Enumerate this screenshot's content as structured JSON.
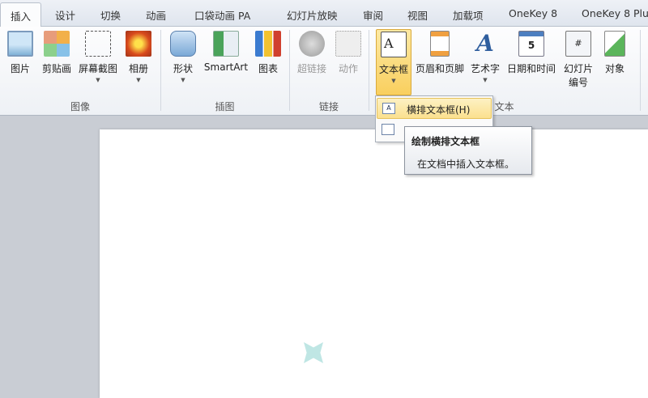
{
  "tabs": [
    "插入",
    "设计",
    "切换",
    "动画",
    "口袋动画 PA",
    "幻灯片放映",
    "审阅",
    "视图",
    "加载项",
    "OneKey 8",
    "OneKey 8 Plus"
  ],
  "groups": {
    "images": "图像",
    "illustrations": "插图",
    "links": "链接",
    "text": "文本"
  },
  "buttons": {
    "picture": "图片",
    "clipart": "剪贴画",
    "screenshot": "屏幕截图",
    "album": "相册",
    "shapes": "形状",
    "smartart": "SmartArt",
    "chart": "图表",
    "hyperlink": "超链接",
    "action": "动作",
    "textbox": "文本框",
    "header_footer": "页眉和页脚",
    "wordart": "艺术字",
    "datetime": "日期和时间",
    "slide_number_1": "幻灯片",
    "slide_number_2": "编号",
    "object": "对象"
  },
  "menu": {
    "horizontal": "横排文本框(H)",
    "horizontal_icon": "A"
  },
  "tooltip": {
    "title": "绘制横排文本框",
    "desc": "在文档中插入文本框。"
  }
}
